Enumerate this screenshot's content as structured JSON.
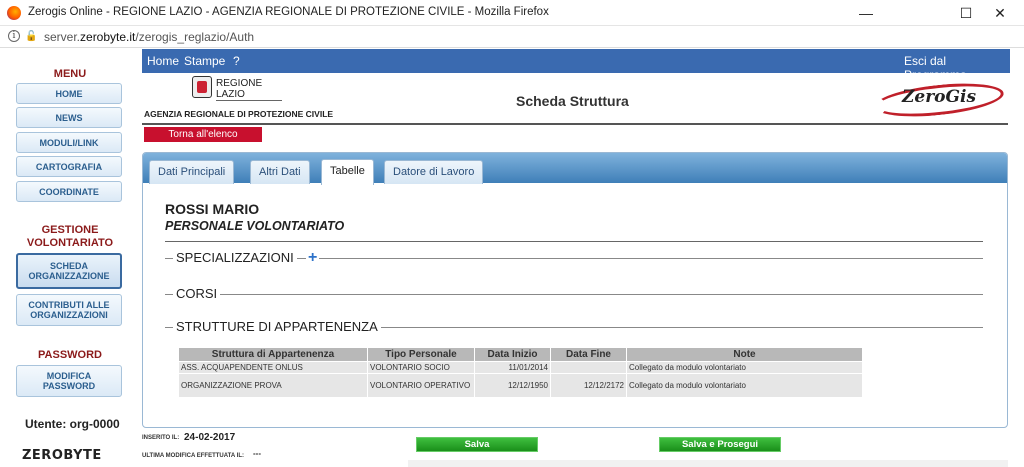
{
  "window": {
    "title": "Zerogis Online - REGIONE LAZIO - AGENZIA REGIONALE DI PROTEZIONE CIVILE - Mozilla Firefox",
    "minimize": "—",
    "maximize": "☐",
    "close": "✕"
  },
  "address": {
    "url_prefix": "server.",
    "url_domain": "zerobyte.it",
    "url_path": "/zerogis_reglazio/Auth"
  },
  "sidebar": {
    "menu_heading": "MENU",
    "menu_items": [
      "HOME",
      "NEWS",
      "MODULI/LINK",
      "CARTOGRAFIA",
      "COORDINATE"
    ],
    "gestione_heading_1": "GESTIONE",
    "gestione_heading_2": "VOLONTARIATO",
    "gestione_items": [
      {
        "line1": "SCHEDA",
        "line2": "ORGANIZZAZIONE"
      },
      {
        "line1": "CONTRIBUTI ALLE",
        "line2": "ORGANIZZAZIONI"
      }
    ],
    "password_heading": "PASSWORD",
    "password_item": {
      "line1": "MODIFICA",
      "line2": "PASSWORD"
    },
    "user_label": "Utente: org-0000",
    "logo_text": "ZEROBYTE"
  },
  "topnav": {
    "home": "Home",
    "stampe": "Stampe",
    "help": "?",
    "exit": "Esci dal Programma"
  },
  "header": {
    "regione_line1": "REGIONE",
    "regione_line2": "LAZIO",
    "agency": "AGENZIA REGIONALE DI PROTEZIONE CIVILE",
    "page_title": "Scheda Struttura",
    "zerogis_logo": "ZeroGis"
  },
  "back_button": "Torna all'elenco",
  "tabs": [
    "Dati Principali",
    "Altri Dati",
    "Tabelle",
    "Datore di Lavoro"
  ],
  "person": {
    "name": "ROSSI MARIO",
    "type": "PERSONALE VOLONTARIATO"
  },
  "sections": {
    "specializzazioni": "SPECIALIZZAZIONI",
    "corsi": "CORSI",
    "strutture": "STRUTTURE DI APPARTENENZA"
  },
  "table": {
    "headers": [
      "Struttura di Appartenenza",
      "Tipo Personale",
      "Data Inizio",
      "Data Fine",
      "Note"
    ],
    "rows": [
      [
        "ASS. ACQUAPENDENTE ONLUS",
        "VOLONTARIO SOCIO",
        "11/01/2014",
        "",
        "Collegato da modulo volontariato"
      ],
      [
        "ORGANIZZAZIONE PROVA",
        "VOLONTARIO OPERATIVO",
        "12/12/1950",
        "12/12/2172",
        "Collegato da modulo volontariato"
      ]
    ]
  },
  "footer": {
    "inserito_label": "INSERITO IL:",
    "inserito_value": "24-02-2017",
    "modifica_label": "ULTIMA MODIFICA EFFETTUATA IL:",
    "modifica_value": "---",
    "salva": "Salva",
    "salva_prosegui": "Salva e Prosegui"
  }
}
